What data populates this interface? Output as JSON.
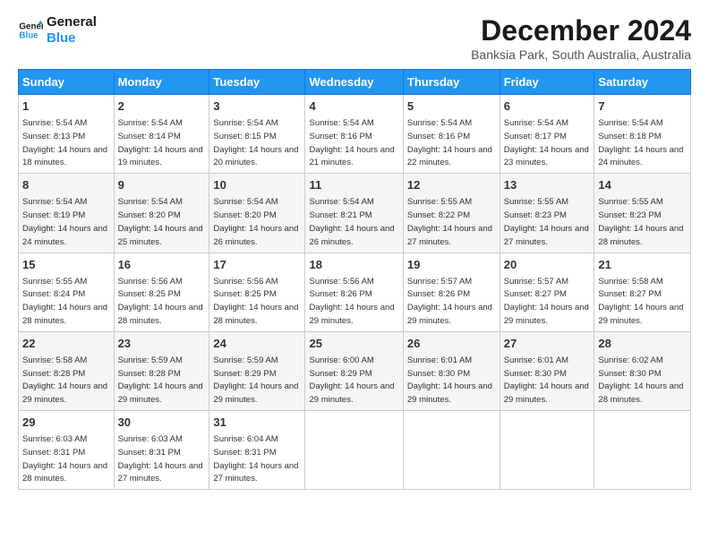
{
  "logo": {
    "line1": "General",
    "line2": "Blue"
  },
  "title": "December 2024",
  "location": "Banksia Park, South Australia, Australia",
  "days_of_week": [
    "Sunday",
    "Monday",
    "Tuesday",
    "Wednesday",
    "Thursday",
    "Friday",
    "Saturday"
  ],
  "weeks": [
    [
      {
        "day": "1",
        "sunrise": "Sunrise: 5:54 AM",
        "sunset": "Sunset: 8:13 PM",
        "daylight": "Daylight: 14 hours and 18 minutes."
      },
      {
        "day": "2",
        "sunrise": "Sunrise: 5:54 AM",
        "sunset": "Sunset: 8:14 PM",
        "daylight": "Daylight: 14 hours and 19 minutes."
      },
      {
        "day": "3",
        "sunrise": "Sunrise: 5:54 AM",
        "sunset": "Sunset: 8:15 PM",
        "daylight": "Daylight: 14 hours and 20 minutes."
      },
      {
        "day": "4",
        "sunrise": "Sunrise: 5:54 AM",
        "sunset": "Sunset: 8:16 PM",
        "daylight": "Daylight: 14 hours and 21 minutes."
      },
      {
        "day": "5",
        "sunrise": "Sunrise: 5:54 AM",
        "sunset": "Sunset: 8:16 PM",
        "daylight": "Daylight: 14 hours and 22 minutes."
      },
      {
        "day": "6",
        "sunrise": "Sunrise: 5:54 AM",
        "sunset": "Sunset: 8:17 PM",
        "daylight": "Daylight: 14 hours and 23 minutes."
      },
      {
        "day": "7",
        "sunrise": "Sunrise: 5:54 AM",
        "sunset": "Sunset: 8:18 PM",
        "daylight": "Daylight: 14 hours and 24 minutes."
      }
    ],
    [
      {
        "day": "8",
        "sunrise": "Sunrise: 5:54 AM",
        "sunset": "Sunset: 8:19 PM",
        "daylight": "Daylight: 14 hours and 24 minutes."
      },
      {
        "day": "9",
        "sunrise": "Sunrise: 5:54 AM",
        "sunset": "Sunset: 8:20 PM",
        "daylight": "Daylight: 14 hours and 25 minutes."
      },
      {
        "day": "10",
        "sunrise": "Sunrise: 5:54 AM",
        "sunset": "Sunset: 8:20 PM",
        "daylight": "Daylight: 14 hours and 26 minutes."
      },
      {
        "day": "11",
        "sunrise": "Sunrise: 5:54 AM",
        "sunset": "Sunset: 8:21 PM",
        "daylight": "Daylight: 14 hours and 26 minutes."
      },
      {
        "day": "12",
        "sunrise": "Sunrise: 5:55 AM",
        "sunset": "Sunset: 8:22 PM",
        "daylight": "Daylight: 14 hours and 27 minutes."
      },
      {
        "day": "13",
        "sunrise": "Sunrise: 5:55 AM",
        "sunset": "Sunset: 8:23 PM",
        "daylight": "Daylight: 14 hours and 27 minutes."
      },
      {
        "day": "14",
        "sunrise": "Sunrise: 5:55 AM",
        "sunset": "Sunset: 8:23 PM",
        "daylight": "Daylight: 14 hours and 28 minutes."
      }
    ],
    [
      {
        "day": "15",
        "sunrise": "Sunrise: 5:55 AM",
        "sunset": "Sunset: 8:24 PM",
        "daylight": "Daylight: 14 hours and 28 minutes."
      },
      {
        "day": "16",
        "sunrise": "Sunrise: 5:56 AM",
        "sunset": "Sunset: 8:25 PM",
        "daylight": "Daylight: 14 hours and 28 minutes."
      },
      {
        "day": "17",
        "sunrise": "Sunrise: 5:56 AM",
        "sunset": "Sunset: 8:25 PM",
        "daylight": "Daylight: 14 hours and 28 minutes."
      },
      {
        "day": "18",
        "sunrise": "Sunrise: 5:56 AM",
        "sunset": "Sunset: 8:26 PM",
        "daylight": "Daylight: 14 hours and 29 minutes."
      },
      {
        "day": "19",
        "sunrise": "Sunrise: 5:57 AM",
        "sunset": "Sunset: 8:26 PM",
        "daylight": "Daylight: 14 hours and 29 minutes."
      },
      {
        "day": "20",
        "sunrise": "Sunrise: 5:57 AM",
        "sunset": "Sunset: 8:27 PM",
        "daylight": "Daylight: 14 hours and 29 minutes."
      },
      {
        "day": "21",
        "sunrise": "Sunrise: 5:58 AM",
        "sunset": "Sunset: 8:27 PM",
        "daylight": "Daylight: 14 hours and 29 minutes."
      }
    ],
    [
      {
        "day": "22",
        "sunrise": "Sunrise: 5:58 AM",
        "sunset": "Sunset: 8:28 PM",
        "daylight": "Daylight: 14 hours and 29 minutes."
      },
      {
        "day": "23",
        "sunrise": "Sunrise: 5:59 AM",
        "sunset": "Sunset: 8:28 PM",
        "daylight": "Daylight: 14 hours and 29 minutes."
      },
      {
        "day": "24",
        "sunrise": "Sunrise: 5:59 AM",
        "sunset": "Sunset: 8:29 PM",
        "daylight": "Daylight: 14 hours and 29 minutes."
      },
      {
        "day": "25",
        "sunrise": "Sunrise: 6:00 AM",
        "sunset": "Sunset: 8:29 PM",
        "daylight": "Daylight: 14 hours and 29 minutes."
      },
      {
        "day": "26",
        "sunrise": "Sunrise: 6:01 AM",
        "sunset": "Sunset: 8:30 PM",
        "daylight": "Daylight: 14 hours and 29 minutes."
      },
      {
        "day": "27",
        "sunrise": "Sunrise: 6:01 AM",
        "sunset": "Sunset: 8:30 PM",
        "daylight": "Daylight: 14 hours and 29 minutes."
      },
      {
        "day": "28",
        "sunrise": "Sunrise: 6:02 AM",
        "sunset": "Sunset: 8:30 PM",
        "daylight": "Daylight: 14 hours and 28 minutes."
      }
    ],
    [
      {
        "day": "29",
        "sunrise": "Sunrise: 6:03 AM",
        "sunset": "Sunset: 8:31 PM",
        "daylight": "Daylight: 14 hours and 28 minutes."
      },
      {
        "day": "30",
        "sunrise": "Sunrise: 6:03 AM",
        "sunset": "Sunset: 8:31 PM",
        "daylight": "Daylight: 14 hours and 27 minutes."
      },
      {
        "day": "31",
        "sunrise": "Sunrise: 6:04 AM",
        "sunset": "Sunset: 8:31 PM",
        "daylight": "Daylight: 14 hours and 27 minutes."
      },
      null,
      null,
      null,
      null
    ]
  ]
}
